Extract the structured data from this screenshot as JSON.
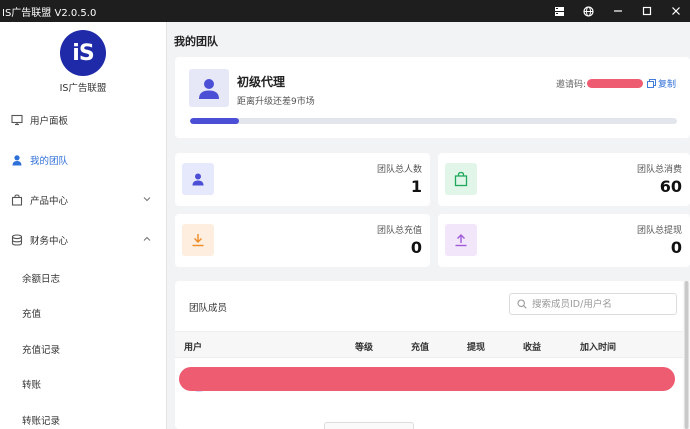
{
  "window": {
    "title": "IS广告联盟 V2.0.5.0"
  },
  "sidebar": {
    "brand": "IS广告联盟",
    "logo_text": "iS",
    "items": [
      {
        "label": "用户面板"
      },
      {
        "label": "我的团队"
      },
      {
        "label": "产品中心"
      },
      {
        "label": "财务中心"
      }
    ],
    "sub_items": [
      {
        "label": "余额日志"
      },
      {
        "label": "充值"
      },
      {
        "label": "充值记录"
      },
      {
        "label": "转账"
      },
      {
        "label": "转账记录"
      }
    ]
  },
  "page": {
    "title": "我的团队"
  },
  "level": {
    "name": "初级代理",
    "subtitle": "距离升级还差9市场",
    "invite_label": "邀请码:",
    "copy_label": "复制",
    "progress": 0.1
  },
  "stats": [
    {
      "label": "团队总人数",
      "value": "1",
      "color": "#4b4fd6",
      "bg": "#e6e8fb"
    },
    {
      "label": "团队总消费",
      "value": "60",
      "color": "#1fa85c",
      "bg": "#e1f6e9"
    },
    {
      "label": "团队总充值",
      "value": "0",
      "color": "#f08a24",
      "bg": "#fdeee0"
    },
    {
      "label": "团队总提现",
      "value": "0",
      "color": "#a05ad8",
      "bg": "#f2e6fb"
    }
  ],
  "members": {
    "title": "团队成员",
    "search_placeholder": "搜索成员ID/用户名",
    "columns": [
      "用户",
      "等级",
      "充值",
      "提现",
      "收益",
      "加入时间"
    ]
  },
  "colors": {
    "accent": "#2f6fd8",
    "brand": "#1f2aa8",
    "redaction": "#ee5c72"
  }
}
